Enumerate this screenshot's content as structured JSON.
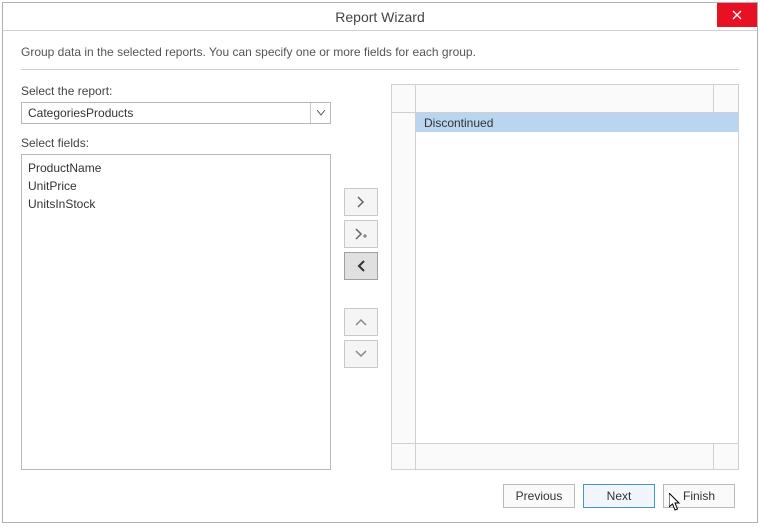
{
  "window": {
    "title": "Report Wizard"
  },
  "instruction": "Group data in the selected reports. You can specify one or more fields for each group.",
  "labels": {
    "select_report": "Select the report:",
    "select_fields": "Select fields:"
  },
  "report_combo": {
    "value": "CategoriesProducts"
  },
  "fields_list": [
    "ProductName",
    "UnitPrice",
    "UnitsInStock"
  ],
  "group_rows": [
    {
      "label": "Discontinued",
      "selected": true
    }
  ],
  "buttons": {
    "previous": "Previous",
    "next": "Next",
    "finish": "Finish"
  }
}
